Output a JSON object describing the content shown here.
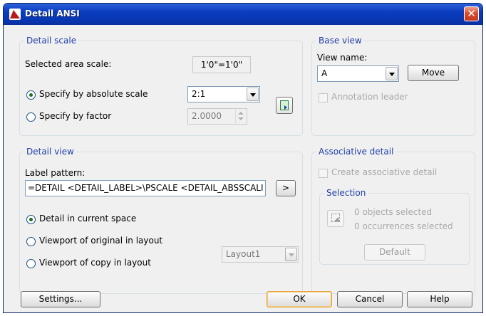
{
  "window": {
    "title": "Detail ANSI",
    "close_glyph": "✕"
  },
  "detail_scale": {
    "legend": "Detail scale",
    "selected_area_label": "Selected area scale:",
    "selected_area_value": "1'0\"=1'0\"",
    "absolute_label": "Specify by absolute scale",
    "absolute_value": "2:1",
    "absolute_checked": true,
    "factor_label": "Specify by factor",
    "factor_value": "2.0000",
    "factor_checked": false,
    "pick_icon": "pick-scale-icon"
  },
  "base_view": {
    "legend": "Base view",
    "view_name_label": "View name:",
    "view_name_value": "A",
    "move_button": "Move",
    "annotation_leader_label": "Annotation leader"
  },
  "detail_view": {
    "legend": "Detail view",
    "label_pattern_label": "Label pattern:",
    "label_pattern_value": "=DETAIL <DETAIL_LABEL>\\PSCALE <DETAIL_ABSSCALI",
    "insert_button": ">",
    "option_current_space": "Detail in current space",
    "option_viewport_original": "Viewport of original in layout",
    "option_viewport_copy": "Viewport of copy in layout",
    "selected_option": "current_space",
    "layout_value": "Layout1"
  },
  "associative_detail": {
    "legend": "Associative detail",
    "create_label": "Create associative detail",
    "selection_legend": "Selection",
    "objects_selected": "0 objects selected",
    "occurrences_selected": "0 occurrences selected",
    "default_button": "Default"
  },
  "footer": {
    "settings_button": "Settings...",
    "ok_button": "OK",
    "cancel_button": "Cancel",
    "help_button": "Help"
  },
  "colors": {
    "legend": "#1f3fa8",
    "titlebar": "#0a3cbf",
    "close": "#d8472b"
  }
}
